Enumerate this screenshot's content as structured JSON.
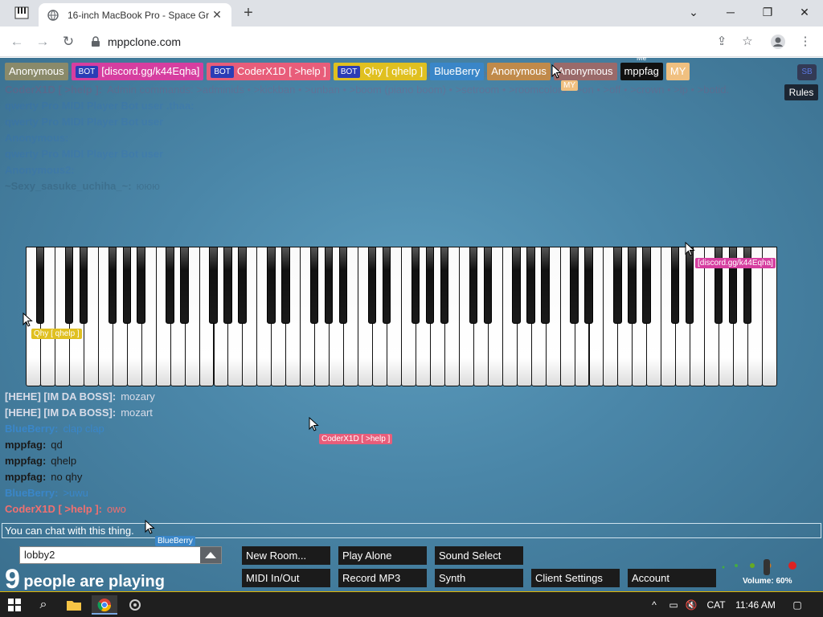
{
  "browser": {
    "tab_title": "16-inch MacBook Pro - Space Gr",
    "url": "mppclone.com",
    "new_tab_glyph": "+",
    "close_glyph": "✕"
  },
  "names": [
    {
      "text": "Anonymous",
      "color": "#8a8a6a",
      "bot": false,
      "me": false
    },
    {
      "text": "[discord.gg/k44Eqha]",
      "color": "#d63ea0",
      "bot": true,
      "me": false
    },
    {
      "text": "CoderX1D [ >help ]",
      "color": "#e85d7a",
      "bot": true,
      "me": false
    },
    {
      "text": "Qhy [ qhelp ]",
      "color": "#e0c020",
      "bot": true,
      "me": false
    },
    {
      "text": "BlueBerry",
      "color": "#3a86c8",
      "bot": false,
      "me": false
    },
    {
      "text": "Anonymous",
      "color": "#c08a4a",
      "bot": false,
      "me": false
    },
    {
      "text": "Anonymous",
      "color": "#9a6a6a",
      "bot": false,
      "me": false
    },
    {
      "text": "mppfag",
      "color": "#111111",
      "bot": false,
      "me": true
    },
    {
      "text": "MY",
      "color": "#f0c080",
      "bot": false,
      "me": false
    }
  ],
  "labels": {
    "bot": "BOT",
    "me": "Me",
    "rules": "Rules",
    "corner": "SB"
  },
  "chat": {
    "top": [
      {
        "name": "CoderX1D [ >help ]:",
        "text": "Fun: >uwu • >owo • >yes • >no • >cat • >dog • >fox • >bird • >mathrace • >say • >eat • >drink • >kill • >hug • >kiss • >me.",
        "nc": "#c83060",
        "tc": "#c83060"
      },
      {
        "name": "CoderX1D [ >help ]:",
        "text": "Admin commands: >adminids • >kickban • >unban • >boom (piano boom) • >setroom • >roomcolors • >on • >off • >crown • >ip • >botid.",
        "nc": "#c83060",
        "tc": "#c83060"
      },
      {
        "name": "qwerty Pro MIDI Player Bot user .thaa:",
        "text": "",
        "nc": "#2a6ad0",
        "tc": "#2a6ad0"
      },
      {
        "name": "qwerty Pro MIDI Player Bot user",
        "text": "",
        "nc": "#2a6ad0",
        "tc": "#2a6ad0"
      },
      {
        "name": "Anonymous:",
        "text": "",
        "nc": "#2a6ad0",
        "tc": "#2a6ad0"
      },
      {
        "name": "qwerty Pro MIDI Player Bot user",
        "text": "",
        "nc": "#2a6ad0",
        "tc": "#2a6ad0"
      },
      {
        "name": "Anonymous2:",
        "text": "",
        "nc": "#2a6ad0",
        "tc": "#2a6ad0"
      },
      {
        "name": "~Sexy_sasuke_uchiha_~:",
        "text": "ююю",
        "nc": "#1a2a3a",
        "tc": "#1a2a3a"
      }
    ],
    "bottom": [
      {
        "name": "[HEHE] [IM DA BOSS]:",
        "text": "mozary",
        "nc": "#d8dce8",
        "tc": "#d8dce8"
      },
      {
        "name": "[HEHE] [IM DA BOSS]:",
        "text": "mozart",
        "nc": "#d8dce8",
        "tc": "#d8dce8"
      },
      {
        "name": "BlueBerry:",
        "text": "clap clap",
        "nc": "#3a86c8",
        "tc": "#3a86c8"
      },
      {
        "name": "mppfag:",
        "text": "qd",
        "nc": "#1a1a1a",
        "tc": "#1a1a1a"
      },
      {
        "name": "mppfag:",
        "text": "qhelp",
        "nc": "#1a1a1a",
        "tc": "#1a1a1a"
      },
      {
        "name": "mppfag:",
        "text": "no qhy",
        "nc": "#1a1a1a",
        "tc": "#1a1a1a"
      },
      {
        "name": "BlueBerry:",
        "text": ">uwu",
        "nc": "#3a86c8",
        "tc": "#3a86c8"
      },
      {
        "name": "CoderX1D [ >help ]:",
        "text": "owo",
        "nc": "#f07070",
        "tc": "#f07070"
      }
    ]
  },
  "cursors": [
    {
      "label": "MY",
      "color": "#f0c080"
    },
    {
      "label": "[discord.gg/k44Eqha]",
      "color": "#d63ea0"
    },
    {
      "label": "Qhy [ qhelp ]",
      "color": "#e0c020"
    },
    {
      "label": "CoderX1D [ >help ]",
      "color": "#e85d7a"
    },
    {
      "label": "BlueBerry",
      "color": "#3a86c8"
    }
  ],
  "chat_input": {
    "placeholder": "You can chat with this thing."
  },
  "room": {
    "name": "lobby2"
  },
  "playing": {
    "count": "9",
    "text": "people are playing"
  },
  "buttons": {
    "new_room": "New Room...",
    "play_alone": "Play Alone",
    "sound_select": "Sound Select",
    "midi": "MIDI In/Out",
    "record": "Record MP3",
    "synth": "Synth",
    "client_settings": "Client Settings",
    "account": "Account"
  },
  "volume": {
    "label": "Volume: 60%",
    "value": 0.6
  },
  "taskbar": {
    "lang": "CAT",
    "time": "11:46 AM",
    "chevron": "^"
  }
}
